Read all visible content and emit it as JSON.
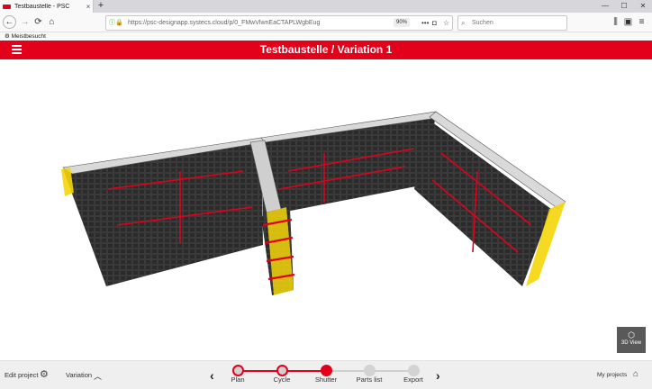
{
  "browser": {
    "tab_title": "Testbaustelle - PSC",
    "tab_close": "×",
    "new_tab": "+",
    "window_controls": [
      "—",
      "☐",
      "✕"
    ],
    "url": "https://psc-designapp.systecs.cloud/p/0_FMwVlwnEaCTAPLWgbEug",
    "zoom": "90%",
    "search_placeholder": "Suchen",
    "bookmark": "Meistbesucht"
  },
  "app": {
    "title": "Testbaustelle / Variation 1",
    "view_3d_label": "3D View"
  },
  "bottom": {
    "edit_project": "Edit project",
    "variation": "Variation",
    "my_projects": "My projects",
    "steps": [
      {
        "label": "Plan",
        "state": "done"
      },
      {
        "label": "Cycle",
        "state": "done"
      },
      {
        "label": "Shutter",
        "state": "active"
      },
      {
        "label": "Parts list",
        "state": "future"
      },
      {
        "label": "Export",
        "state": "future"
      }
    ]
  },
  "colors": {
    "brand": "#e2001a",
    "formwork": "#2b2b2b",
    "wall_top": "#d9d9d9",
    "accent_yellow": "#f5d60a"
  }
}
